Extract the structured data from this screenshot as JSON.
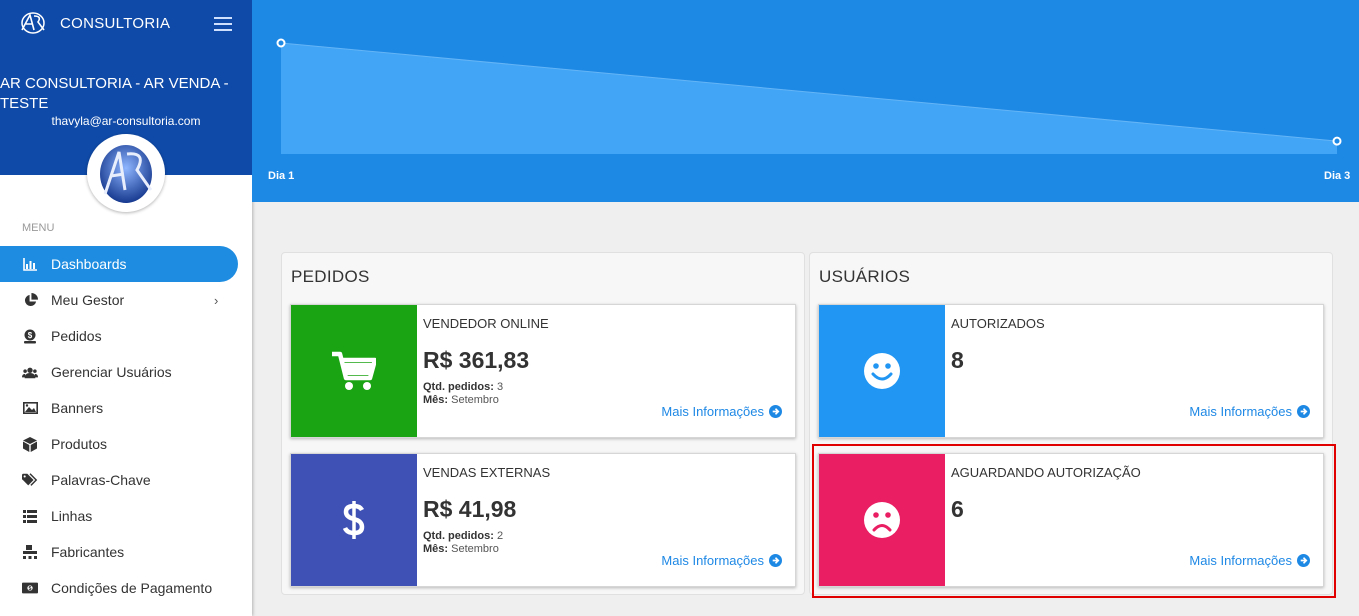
{
  "sidebar": {
    "brand": "CONSULTORIA",
    "company": "AR CONSULTORIA - AR VENDA - TESTE",
    "email": "thavyla@ar-consultoria.com",
    "menu_label": "MENU",
    "items": [
      {
        "label": "Dashboards",
        "icon": "bar-chart-icon",
        "active": true
      },
      {
        "label": "Meu Gestor",
        "icon": "pie-chart-icon",
        "has_submenu": true
      },
      {
        "label": "Pedidos",
        "icon": "money-bag-icon"
      },
      {
        "label": "Gerenciar Usuários",
        "icon": "users-icon"
      },
      {
        "label": "Banners",
        "icon": "image-icon"
      },
      {
        "label": "Produtos",
        "icon": "box-icon"
      },
      {
        "label": "Palavras-Chave",
        "icon": "tags-icon"
      },
      {
        "label": "Linhas",
        "icon": "list-icon"
      },
      {
        "label": "Fabricantes",
        "icon": "pallet-icon"
      },
      {
        "label": "Condições de Pagamento",
        "icon": "cash-icon"
      }
    ]
  },
  "chart_data": {
    "type": "area",
    "categories": [
      "Dia 1",
      "Dia 3"
    ],
    "values": [
      361.83,
      41.98
    ]
  },
  "pedidos": {
    "title": "PEDIDOS",
    "cards": [
      {
        "title": "VENDEDOR ONLINE",
        "value": "R$ 361,83",
        "qtd_label": "Qtd. pedidos:",
        "qtd": "3",
        "mes_label": "Mês:",
        "mes": "Setembro",
        "link": "Mais Informações",
        "color": "#1aa313",
        "icon": "cart-icon"
      },
      {
        "title": "VENDAS EXTERNAS",
        "value": "R$ 41,98",
        "qtd_label": "Qtd. pedidos:",
        "qtd": "2",
        "mes_label": "Mês:",
        "mes": "Setembro",
        "link": "Mais Informações",
        "color": "#3f51b5",
        "icon": "dollar-icon"
      }
    ]
  },
  "usuarios": {
    "title": "USUÁRIOS",
    "cards": [
      {
        "title": "AUTORIZADOS",
        "value": "8",
        "link": "Mais Informações",
        "color": "#2196f3",
        "icon": "smile-icon"
      },
      {
        "title": "AGUARDANDO AUTORIZAÇÃO",
        "value": "6",
        "link": "Mais Informações",
        "color": "#e91e63",
        "icon": "frown-icon"
      }
    ]
  }
}
